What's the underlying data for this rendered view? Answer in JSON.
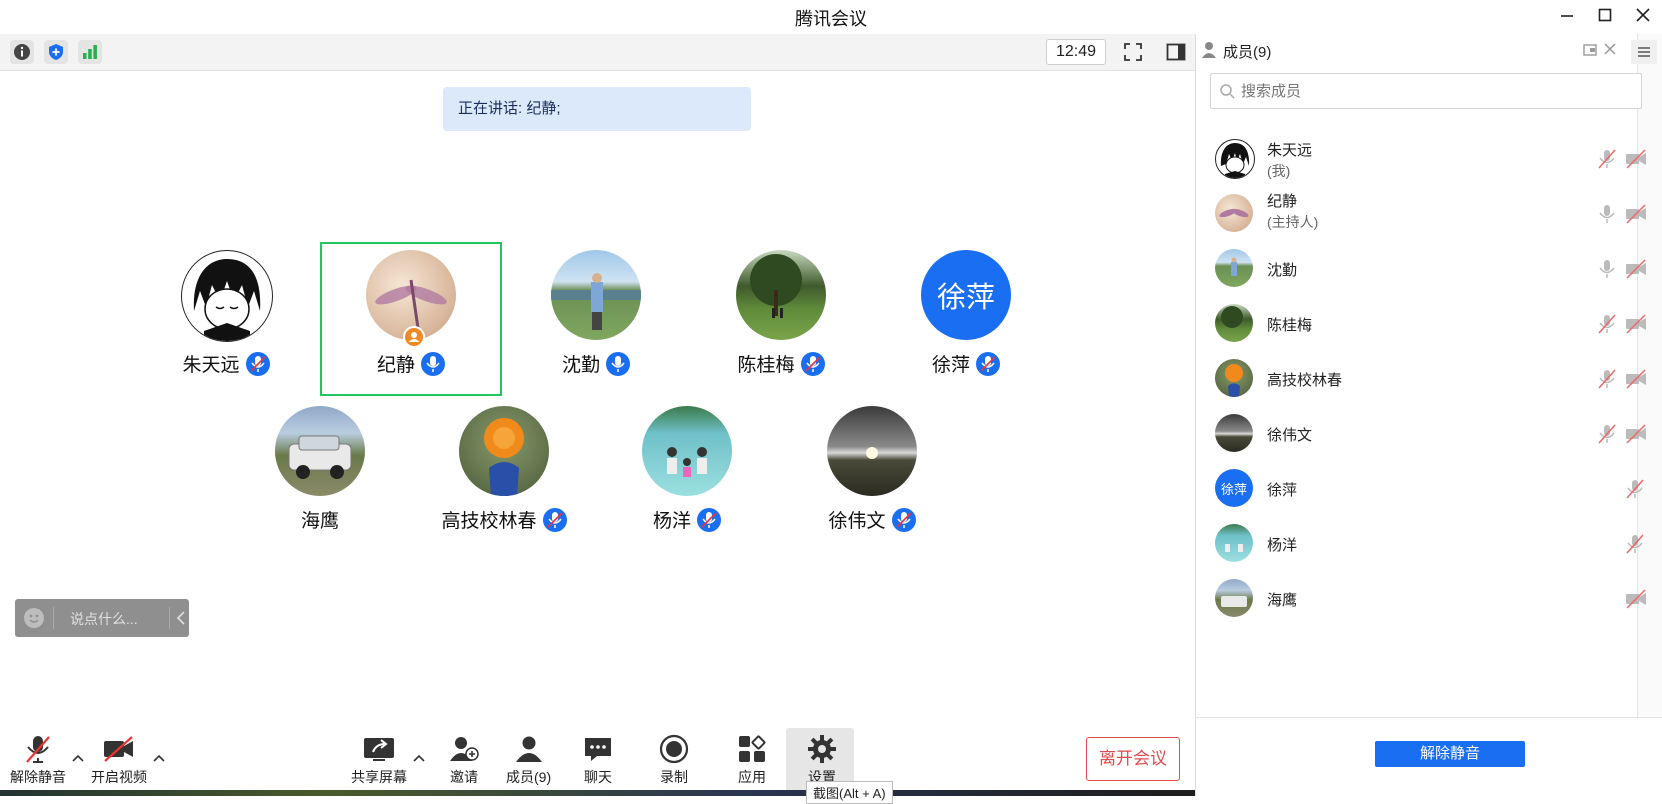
{
  "window": {
    "title": "腾讯会议"
  },
  "toolbar": {
    "clock": "12:49",
    "icons": [
      "info-icon",
      "shield-icon",
      "signal-icon",
      "fullscreen-icon",
      "panel-toggle-icon"
    ]
  },
  "speaking": {
    "text": "正在讲话: 纪静;"
  },
  "participants": [
    {
      "name": "朱天远",
      "avatar": "anime-boy",
      "mic": "muted"
    },
    {
      "name": "纪静",
      "avatar": "dragonfly",
      "mic": "on",
      "host": true
    },
    {
      "name": "沈勤",
      "avatar": "man-lake",
      "mic": "on"
    },
    {
      "name": "陈桂梅",
      "avatar": "trees",
      "mic": "muted"
    },
    {
      "name": "徐萍",
      "avatar": "text",
      "avatar_text": "徐萍",
      "mic": "muted"
    },
    {
      "name": "海鹰",
      "avatar": "car",
      "mic": "none"
    },
    {
      "name": "高技校林春",
      "avatar": "flower",
      "mic": "muted"
    },
    {
      "name": "杨洋",
      "avatar": "family",
      "mic": "muted"
    },
    {
      "name": "徐伟文",
      "avatar": "sunset",
      "mic": "muted"
    }
  ],
  "chat": {
    "placeholder": "说点什么..."
  },
  "bottom_bar": {
    "unmute": "解除静音",
    "video": "开启视频",
    "share": "共享屏幕",
    "invite": "邀请",
    "members": "成员(9)",
    "chat": "聊天",
    "record": "录制",
    "apps": "应用",
    "settings": "设置",
    "leave": "离开会议",
    "tooltip": "截图(Alt + A)"
  },
  "panel": {
    "title": "成员(9)",
    "search_placeholder": "搜索成员",
    "unmute_all": "解除静音",
    "members": [
      {
        "name": "朱天远",
        "role": "(我)",
        "avatar": "anime-boy",
        "mic": "muted",
        "cam": "off"
      },
      {
        "name": "纪静",
        "role": "(主持人)",
        "avatar": "dragonfly",
        "mic": "on",
        "cam": "off"
      },
      {
        "name": "沈勤",
        "role": "",
        "avatar": "man-lake",
        "mic": "on",
        "cam": "off"
      },
      {
        "name": "陈桂梅",
        "role": "",
        "avatar": "trees",
        "mic": "muted",
        "cam": "off"
      },
      {
        "name": "高技校林春",
        "role": "",
        "avatar": "flower",
        "mic": "muted",
        "cam": "off"
      },
      {
        "name": "徐伟文",
        "role": "",
        "avatar": "sunset",
        "mic": "muted",
        "cam": "off"
      },
      {
        "name": "徐萍",
        "role": "",
        "avatar": "text",
        "avatar_text": "徐萍",
        "mic": "muted",
        "cam": "none"
      },
      {
        "name": "杨洋",
        "role": "",
        "avatar": "family",
        "mic": "muted",
        "cam": "none"
      },
      {
        "name": "海鹰",
        "role": "",
        "avatar": "car",
        "mic": "none",
        "cam": "off"
      }
    ]
  },
  "colors": {
    "accent": "#1a6ef2",
    "active_border": "#22c55e",
    "leave": "#e14b4b",
    "banner": "#dbe9fb"
  }
}
